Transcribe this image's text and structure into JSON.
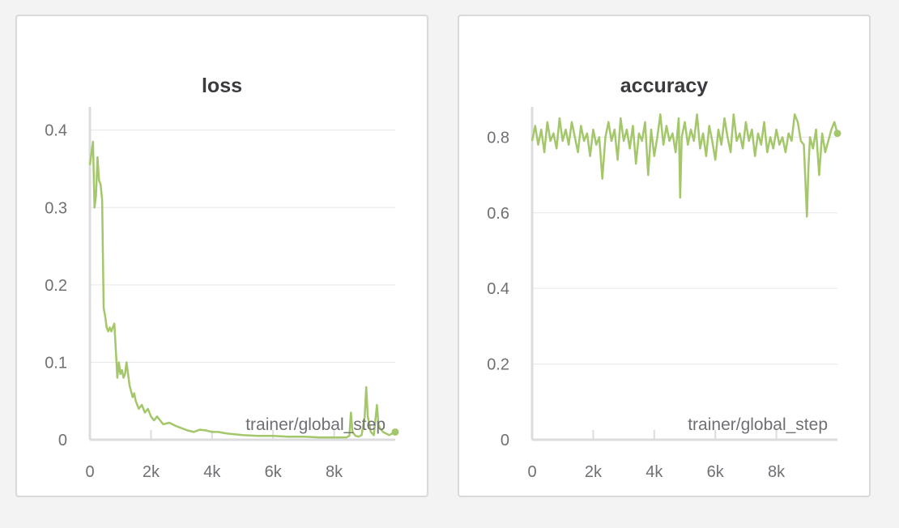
{
  "chart_data": [
    {
      "type": "line",
      "title": "loss",
      "xlabel": "trainer/global_step",
      "ylabel": "",
      "xlim": [
        0,
        10000
      ],
      "ylim": [
        0,
        0.43
      ],
      "xticks": [
        {
          "v": 0,
          "label": "0"
        },
        {
          "v": 2000,
          "label": "2k"
        },
        {
          "v": 4000,
          "label": "4k"
        },
        {
          "v": 6000,
          "label": "6k"
        },
        {
          "v": 8000,
          "label": "8k"
        }
      ],
      "yticks": [
        {
          "v": 0,
          "label": "0"
        },
        {
          "v": 0.1,
          "label": "0.1"
        },
        {
          "v": 0.2,
          "label": "0.2"
        },
        {
          "v": 0.3,
          "label": "0.3"
        },
        {
          "v": 0.4,
          "label": "0.4"
        }
      ],
      "grid": true,
      "color": "#a3c76a",
      "series": [
        {
          "x": [
            0,
            100,
            150,
            200,
            250,
            300,
            350,
            400,
            450,
            500,
            550,
            600,
            650,
            700,
            800,
            900,
            950,
            1000,
            1050,
            1100,
            1150,
            1200,
            1300,
            1400,
            1450,
            1500,
            1600,
            1700,
            1800,
            1900,
            2000,
            2100,
            2200,
            2400,
            2600,
            2800,
            3000,
            3200,
            3400,
            3600,
            3800,
            4000,
            4200,
            4500,
            5000,
            5500,
            6000,
            6500,
            7000,
            7500,
            8000,
            8400,
            8500,
            8550,
            8600,
            8700,
            8800,
            8900,
            9000,
            9050,
            9100,
            9200,
            9300,
            9400,
            9450,
            9500,
            9600,
            9700,
            9800,
            9900,
            10000
          ],
          "y": [
            0.355,
            0.385,
            0.3,
            0.315,
            0.365,
            0.335,
            0.33,
            0.31,
            0.17,
            0.16,
            0.145,
            0.14,
            0.145,
            0.14,
            0.15,
            0.08,
            0.1,
            0.085,
            0.09,
            0.08,
            0.085,
            0.1,
            0.07,
            0.055,
            0.06,
            0.05,
            0.04,
            0.045,
            0.035,
            0.04,
            0.03,
            0.025,
            0.03,
            0.02,
            0.022,
            0.018,
            0.015,
            0.012,
            0.01,
            0.013,
            0.012,
            0.01,
            0.01,
            0.008,
            0.006,
            0.005,
            0.005,
            0.004,
            0.004,
            0.003,
            0.003,
            0.003,
            0.005,
            0.035,
            0.01,
            0.005,
            0.004,
            0.006,
            0.03,
            0.068,
            0.03,
            0.01,
            0.006,
            0.045,
            0.02,
            0.015,
            0.01,
            0.008,
            0.006,
            0.008,
            0.01
          ]
        }
      ]
    },
    {
      "type": "line",
      "title": "accuracy",
      "xlabel": "trainer/global_step",
      "ylabel": "",
      "xlim": [
        0,
        10000
      ],
      "ylim": [
        0,
        0.88
      ],
      "xticks": [
        {
          "v": 0,
          "label": "0"
        },
        {
          "v": 2000,
          "label": "2k"
        },
        {
          "v": 4000,
          "label": "4k"
        },
        {
          "v": 6000,
          "label": "6k"
        },
        {
          "v": 8000,
          "label": "8k"
        }
      ],
      "yticks": [
        {
          "v": 0,
          "label": "0"
        },
        {
          "v": 0.2,
          "label": "0.2"
        },
        {
          "v": 0.4,
          "label": "0.4"
        },
        {
          "v": 0.6,
          "label": "0.6"
        },
        {
          "v": 0.8,
          "label": "0.8"
        }
      ],
      "grid": true,
      "color": "#a3c76a",
      "series": [
        {
          "x": [
            0,
            100,
            200,
            300,
            400,
            500,
            600,
            700,
            800,
            900,
            1000,
            1100,
            1200,
            1300,
            1400,
            1500,
            1600,
            1700,
            1800,
            1900,
            2000,
            2100,
            2200,
            2300,
            2400,
            2500,
            2600,
            2700,
            2800,
            2900,
            3000,
            3100,
            3200,
            3300,
            3400,
            3500,
            3600,
            3700,
            3800,
            3900,
            4000,
            4100,
            4200,
            4300,
            4400,
            4500,
            4600,
            4700,
            4800,
            4850,
            4900,
            5000,
            5100,
            5200,
            5300,
            5400,
            5500,
            5600,
            5700,
            5800,
            5900,
            6000,
            6100,
            6200,
            6300,
            6400,
            6500,
            6600,
            6700,
            6800,
            6900,
            7000,
            7100,
            7200,
            7300,
            7400,
            7500,
            7600,
            7700,
            7800,
            7900,
            8000,
            8100,
            8200,
            8300,
            8400,
            8500,
            8600,
            8700,
            8800,
            8900,
            9000,
            9050,
            9100,
            9200,
            9300,
            9400,
            9500,
            9600,
            9700,
            9800,
            9900,
            10000
          ],
          "y": [
            0.79,
            0.83,
            0.78,
            0.82,
            0.76,
            0.84,
            0.79,
            0.81,
            0.77,
            0.85,
            0.79,
            0.82,
            0.78,
            0.84,
            0.8,
            0.76,
            0.83,
            0.79,
            0.81,
            0.75,
            0.82,
            0.78,
            0.8,
            0.69,
            0.8,
            0.84,
            0.79,
            0.82,
            0.74,
            0.85,
            0.79,
            0.82,
            0.77,
            0.83,
            0.73,
            0.81,
            0.79,
            0.84,
            0.7,
            0.82,
            0.75,
            0.8,
            0.86,
            0.78,
            0.83,
            0.79,
            0.81,
            0.76,
            0.85,
            0.64,
            0.8,
            0.84,
            0.78,
            0.82,
            0.79,
            0.86,
            0.77,
            0.81,
            0.75,
            0.83,
            0.79,
            0.74,
            0.82,
            0.78,
            0.85,
            0.8,
            0.76,
            0.86,
            0.79,
            0.81,
            0.77,
            0.84,
            0.79,
            0.82,
            0.75,
            0.81,
            0.78,
            0.84,
            0.76,
            0.8,
            0.77,
            0.82,
            0.78,
            0.8,
            0.76,
            0.81,
            0.79,
            0.86,
            0.84,
            0.79,
            0.78,
            0.59,
            0.72,
            0.8,
            0.77,
            0.82,
            0.7,
            0.81,
            0.76,
            0.79,
            0.82,
            0.84,
            0.81
          ]
        }
      ]
    }
  ]
}
